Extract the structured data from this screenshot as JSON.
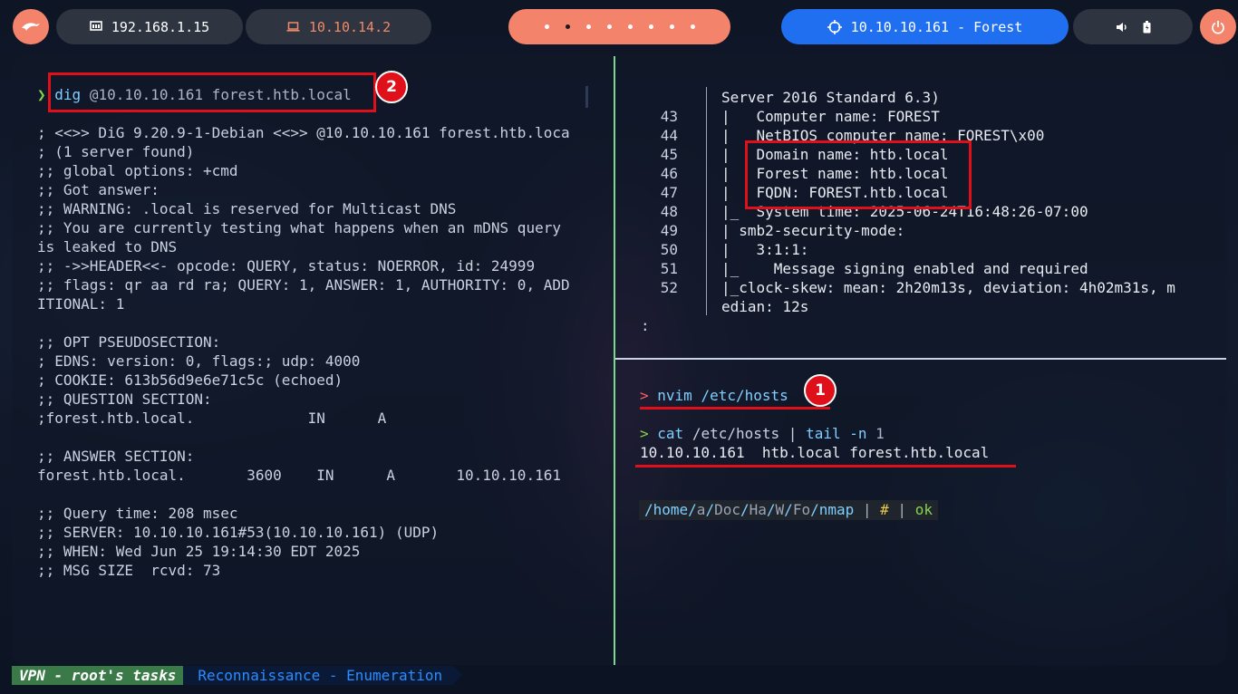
{
  "topbar": {
    "lan_ip": "192.168.1.15",
    "vpn_ip": "10.10.14.2",
    "target": "10.10.10.161 - Forest",
    "icons": [
      "kali-dragon-icon",
      "ethernet-icon",
      "laptop-icon",
      "crosshair-icon",
      "volume-icon",
      "battery-icon",
      "power-icon"
    ],
    "workspaces": 8,
    "active_workspace": 2
  },
  "left_pane": {
    "prompt_symbol": "❯",
    "command": "dig",
    "command_args": " @10.10.10.161 forest.htb.local",
    "badge": "2",
    "output": [
      "; <<>> DiG 9.20.9-1-Debian <<>> @10.10.10.161 forest.htb.loca",
      "; (1 server found)",
      ";; global options: +cmd",
      ";; Got answer:",
      ";; WARNING: .local is reserved for Multicast DNS",
      ";; You are currently testing what happens when an mDNS query",
      "is leaked to DNS",
      ";; ->>HEADER<<- opcode: QUERY, status: NOERROR, id: 24999",
      ";; flags: qr aa rd ra; QUERY: 1, ANSWER: 1, AUTHORITY: 0, ADD",
      "ITIONAL: 1",
      "",
      ";; OPT PSEUDOSECTION:",
      "; EDNS: version: 0, flags:; udp: 4000",
      "; COOKIE: 613b56d9e6e71c5c (echoed)",
      ";; QUESTION SECTION:",
      ";forest.htb.local.             IN      A",
      "",
      ";; ANSWER SECTION:",
      "forest.htb.local.       3600    IN      A       10.10.10.161",
      "",
      ";; Query time: 208 msec",
      ";; SERVER: 10.10.10.161#53(10.10.10.161) (UDP)",
      ";; WHEN: Wed Jun 25 19:14:30 EDT 2025",
      ";; MSG SIZE  rcvd: 73"
    ]
  },
  "right_top": {
    "header_line": "Server 2016 Standard 6.3)",
    "rows": [
      {
        "num": "43",
        "text": "|   Computer name: FOREST"
      },
      {
        "num": "44",
        "text": "|   NetBIOS computer name: FOREST\\x00"
      },
      {
        "num": "45",
        "text": "|   Domain name: htb.local"
      },
      {
        "num": "46",
        "text": "|   Forest name: htb.local"
      },
      {
        "num": "47",
        "text": "|   FQDN: FOREST.htb.local"
      },
      {
        "num": "48",
        "text": "|_  System time: 2025-06-24T16:48:26-07:00"
      },
      {
        "num": "49",
        "text": "| smb2-security-mode:"
      },
      {
        "num": "50",
        "text": "|   3:1:1:"
      },
      {
        "num": "51",
        "text": "|_    Message signing enabled and required"
      },
      {
        "num": "52",
        "text": "|_clock-skew: mean: 2h20m13s, deviation: 4h02m31s, m"
      }
    ],
    "wrap_line": "edian: 12s",
    "pager_prompt": ":"
  },
  "right_bottom": {
    "cmd1_prompt": ">",
    "cmd1": "nvim /etc/hosts",
    "badge": "1",
    "cmd2_prompt": ">",
    "cmd2_cat": "cat",
    "cmd2_path": " /etc/hosts",
    "cmd2_pipe": " | ",
    "cmd2_tail": "tail",
    "cmd2_flag": " -n",
    "cmd2_num": " 1",
    "hosts_line": "10.10.10.161  htb.local forest.htb.local",
    "path_parts": [
      "/home/",
      "a",
      "/",
      "Doc",
      "/",
      "Ha",
      "/",
      "W",
      "/",
      "Fo",
      "/",
      "nmap"
    ],
    "path_sep": " | ",
    "git_symbol": "#",
    "status_ok": "ok"
  },
  "statusbar": {
    "session": "VPN - root's tasks",
    "tab": "Reconnaissance - Enumeration"
  }
}
